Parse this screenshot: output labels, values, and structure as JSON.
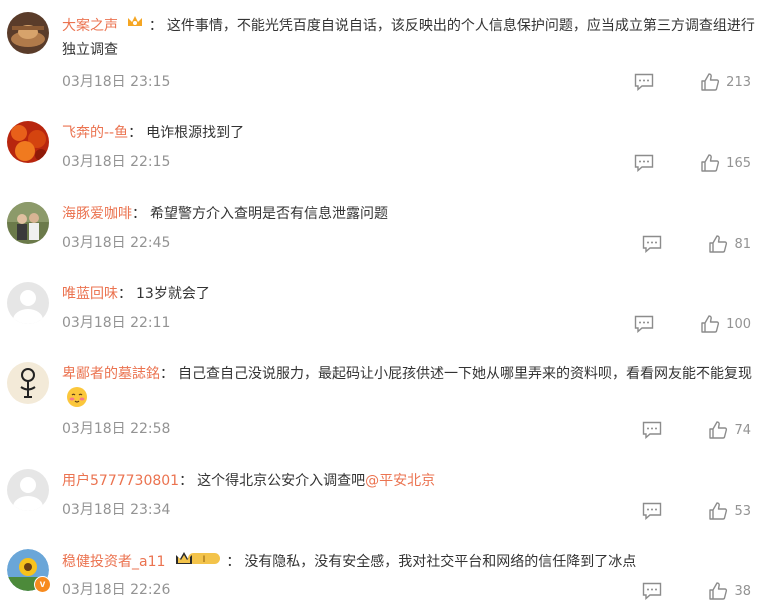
{
  "comments": [
    {
      "user": "大案之声",
      "text": "这件事情，不能光凭百度自说自话，该反映出的个人信息保护问题，应当成立第三方调查组进行独立调查",
      "mention": "",
      "date": "03月18日 23:15",
      "likes": "213",
      "avatar": "bronze-statue"
    },
    {
      "user": "飞奔的--鱼",
      "text": "电诈根源找到了",
      "mention": "",
      "date": "03月18日 22:15",
      "likes": "165",
      "avatar": "red-leaves"
    },
    {
      "user": "海豚爱咖啡",
      "text": "希望警方介入查明是否有信息泄露问题",
      "mention": "",
      "date": "03月18日 22:45",
      "likes": "81",
      "avatar": "couple-photo"
    },
    {
      "user": "唯蓝回味",
      "text": "13岁就会了",
      "mention": "",
      "date": "03月18日 22:11",
      "likes": "100",
      "avatar": "default-user"
    },
    {
      "user": "卑鄙者的墓誌銘",
      "text": "自己查自己没说服力，最起码让小屁孩供述一下她从哪里弄来的资料呗，看看网友能不能复现",
      "mention": "",
      "date": "03月18日 22:58",
      "likes": "74",
      "avatar": "cartoon-face"
    },
    {
      "user": "用户5777730801",
      "text": "这个得北京公安介入调查吧",
      "mention": "@平安北京",
      "date": "03月18日 23:34",
      "likes": "53",
      "avatar": "default-user"
    },
    {
      "user": "稳健投资者_a11",
      "text": "没有隐私，没有安全感，我对社交平台和网络的信任降到了冰点",
      "mention": "",
      "date": "03月18日 22:26",
      "likes": "38",
      "avatar": "sunflower"
    }
  ],
  "colors": {
    "username": "#eb7350",
    "meta": "#939393",
    "text": "#333333"
  },
  "icons": {
    "reply": "comment-icon",
    "like": "thumbs-up-icon",
    "emoji": "blush-emoji-icon",
    "badge": "crown-badge-icon",
    "vip": "verified-badge-icon",
    "vip_label": "v"
  }
}
